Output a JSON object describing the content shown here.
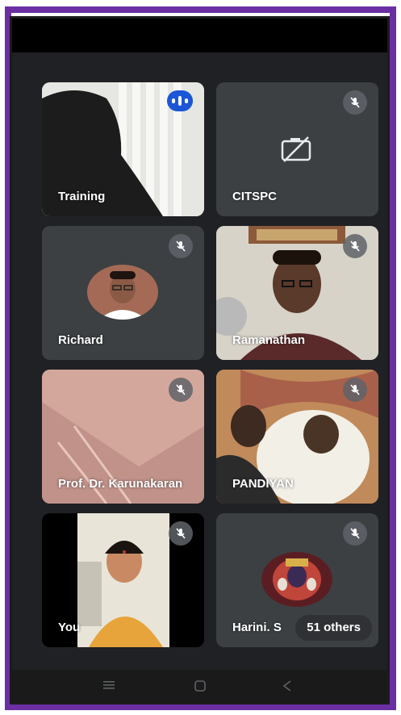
{
  "tiles": [
    {
      "name": "Training",
      "status": "speaking"
    },
    {
      "name": "CITSPC",
      "status": "muted",
      "camera": "off"
    },
    {
      "name": "Richard",
      "status": "muted"
    },
    {
      "name": "Ramanathan",
      "status": "muted"
    },
    {
      "name": "Prof. Dr. Karunakaran",
      "status": "muted"
    },
    {
      "name": "PANDIYAN",
      "status": "muted"
    },
    {
      "name": "You",
      "status": "muted"
    },
    {
      "name": "Harini. S",
      "status": "muted"
    }
  ],
  "others_label": "51 others",
  "icons": {
    "mic": "mic-off-icon",
    "camera": "camera-off-icon",
    "nav": [
      "menu-icon",
      "home-icon",
      "back-icon"
    ]
  },
  "colors": {
    "frame": "#6b2fa3",
    "background": "#202124",
    "tile": "#3c4043",
    "speaking": "#1a56d6"
  }
}
